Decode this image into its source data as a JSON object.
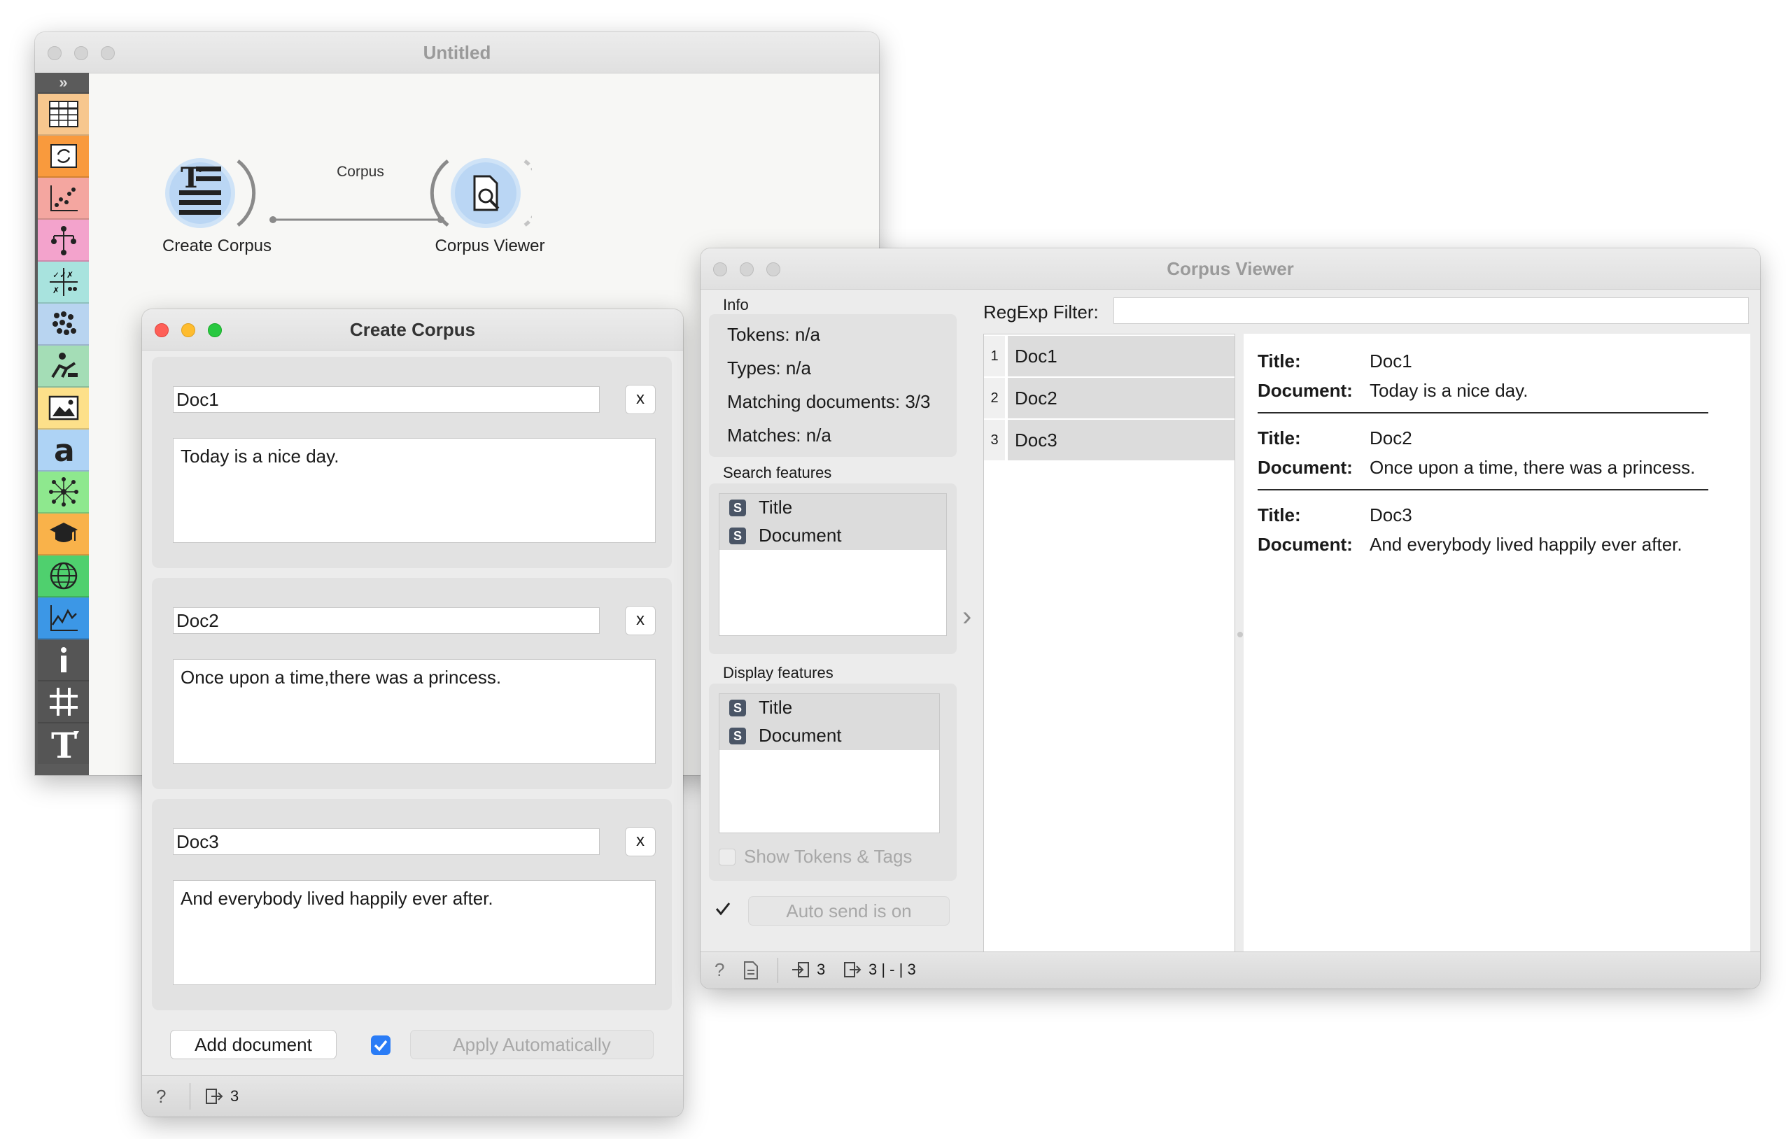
{
  "canvas": {
    "title": "Untitled",
    "link_label": "Corpus",
    "nodes": [
      {
        "label": "Create Corpus",
        "icon": "create-corpus-icon"
      },
      {
        "label": "Corpus Viewer",
        "icon": "corpus-viewer-icon"
      }
    ],
    "toolbox": [
      {
        "icon": "expand-icon",
        "color": "#5b5b5b"
      },
      {
        "icon": "data-table-icon",
        "color": "#f7c78e"
      },
      {
        "icon": "transform-icon",
        "color": "#f99a3d"
      },
      {
        "icon": "visualize-icon",
        "color": "#f4a6a0"
      },
      {
        "icon": "model-tree-icon",
        "color": "#f3a3cc"
      },
      {
        "icon": "evaluate-icon",
        "color": "#a8e3de"
      },
      {
        "icon": "unsupervised-icon",
        "color": "#b8d4f0"
      },
      {
        "icon": "educational-icon",
        "color": "#a4ddb6"
      },
      {
        "icon": "image-analytics-icon",
        "color": "#fde08a"
      },
      {
        "icon": "text-mining-icon",
        "color": "#aed3f5"
      },
      {
        "icon": "network-icon",
        "color": "#8ee88e"
      },
      {
        "icon": "education-cap-icon",
        "color": "#f9b24a"
      },
      {
        "icon": "geo-globe-icon",
        "color": "#4fd06e"
      },
      {
        "icon": "timeseries-icon",
        "color": "#3c97e6"
      },
      {
        "icon": "info-icon",
        "color": "#555555"
      },
      {
        "icon": "hashtag-icon",
        "color": "#555555"
      },
      {
        "icon": "text-t-icon",
        "color": "#555555"
      }
    ]
  },
  "create_corpus": {
    "title": "Create Corpus",
    "documents": [
      {
        "title": "Doc1",
        "text": "Today is a nice day."
      },
      {
        "title": "Doc2",
        "text": "Once upon a time,there was a princess."
      },
      {
        "title": "Doc3",
        "text": "And everybody lived happily ever after."
      }
    ],
    "remove_label": "x",
    "add_document": "Add document",
    "apply_automatically": "Apply Automatically",
    "apply_checked": true,
    "status_output": "3"
  },
  "corpus_viewer": {
    "title": "Corpus Viewer",
    "info_label": "Info",
    "info": {
      "tokens": "Tokens: n/a",
      "types": "Types: n/a",
      "matching": "Matching documents: 3/3",
      "matches": "Matches: n/a"
    },
    "search_features_label": "Search features",
    "search_features": [
      "Title",
      "Document"
    ],
    "display_features_label": "Display features",
    "display_features": [
      "Title",
      "Document"
    ],
    "show_tokens": "Show Tokens & Tags",
    "auto_send": "Auto send is on",
    "filter_label": "RegExp Filter:",
    "filter_value": "",
    "doc_list": [
      {
        "num": "1",
        "name": "Doc1"
      },
      {
        "num": "2",
        "name": "Doc2"
      },
      {
        "num": "3",
        "name": "Doc3"
      }
    ],
    "title_key": "Title:",
    "document_key": "Document:",
    "details": [
      {
        "title": "Doc1",
        "document": "Today is a nice day."
      },
      {
        "title": "Doc2",
        "document": "Once upon a time, there was a princess."
      },
      {
        "title": "Doc3",
        "document": "And everybody lived happily ever after."
      }
    ],
    "status_input": "3",
    "status_output": "3 | - | 3"
  }
}
